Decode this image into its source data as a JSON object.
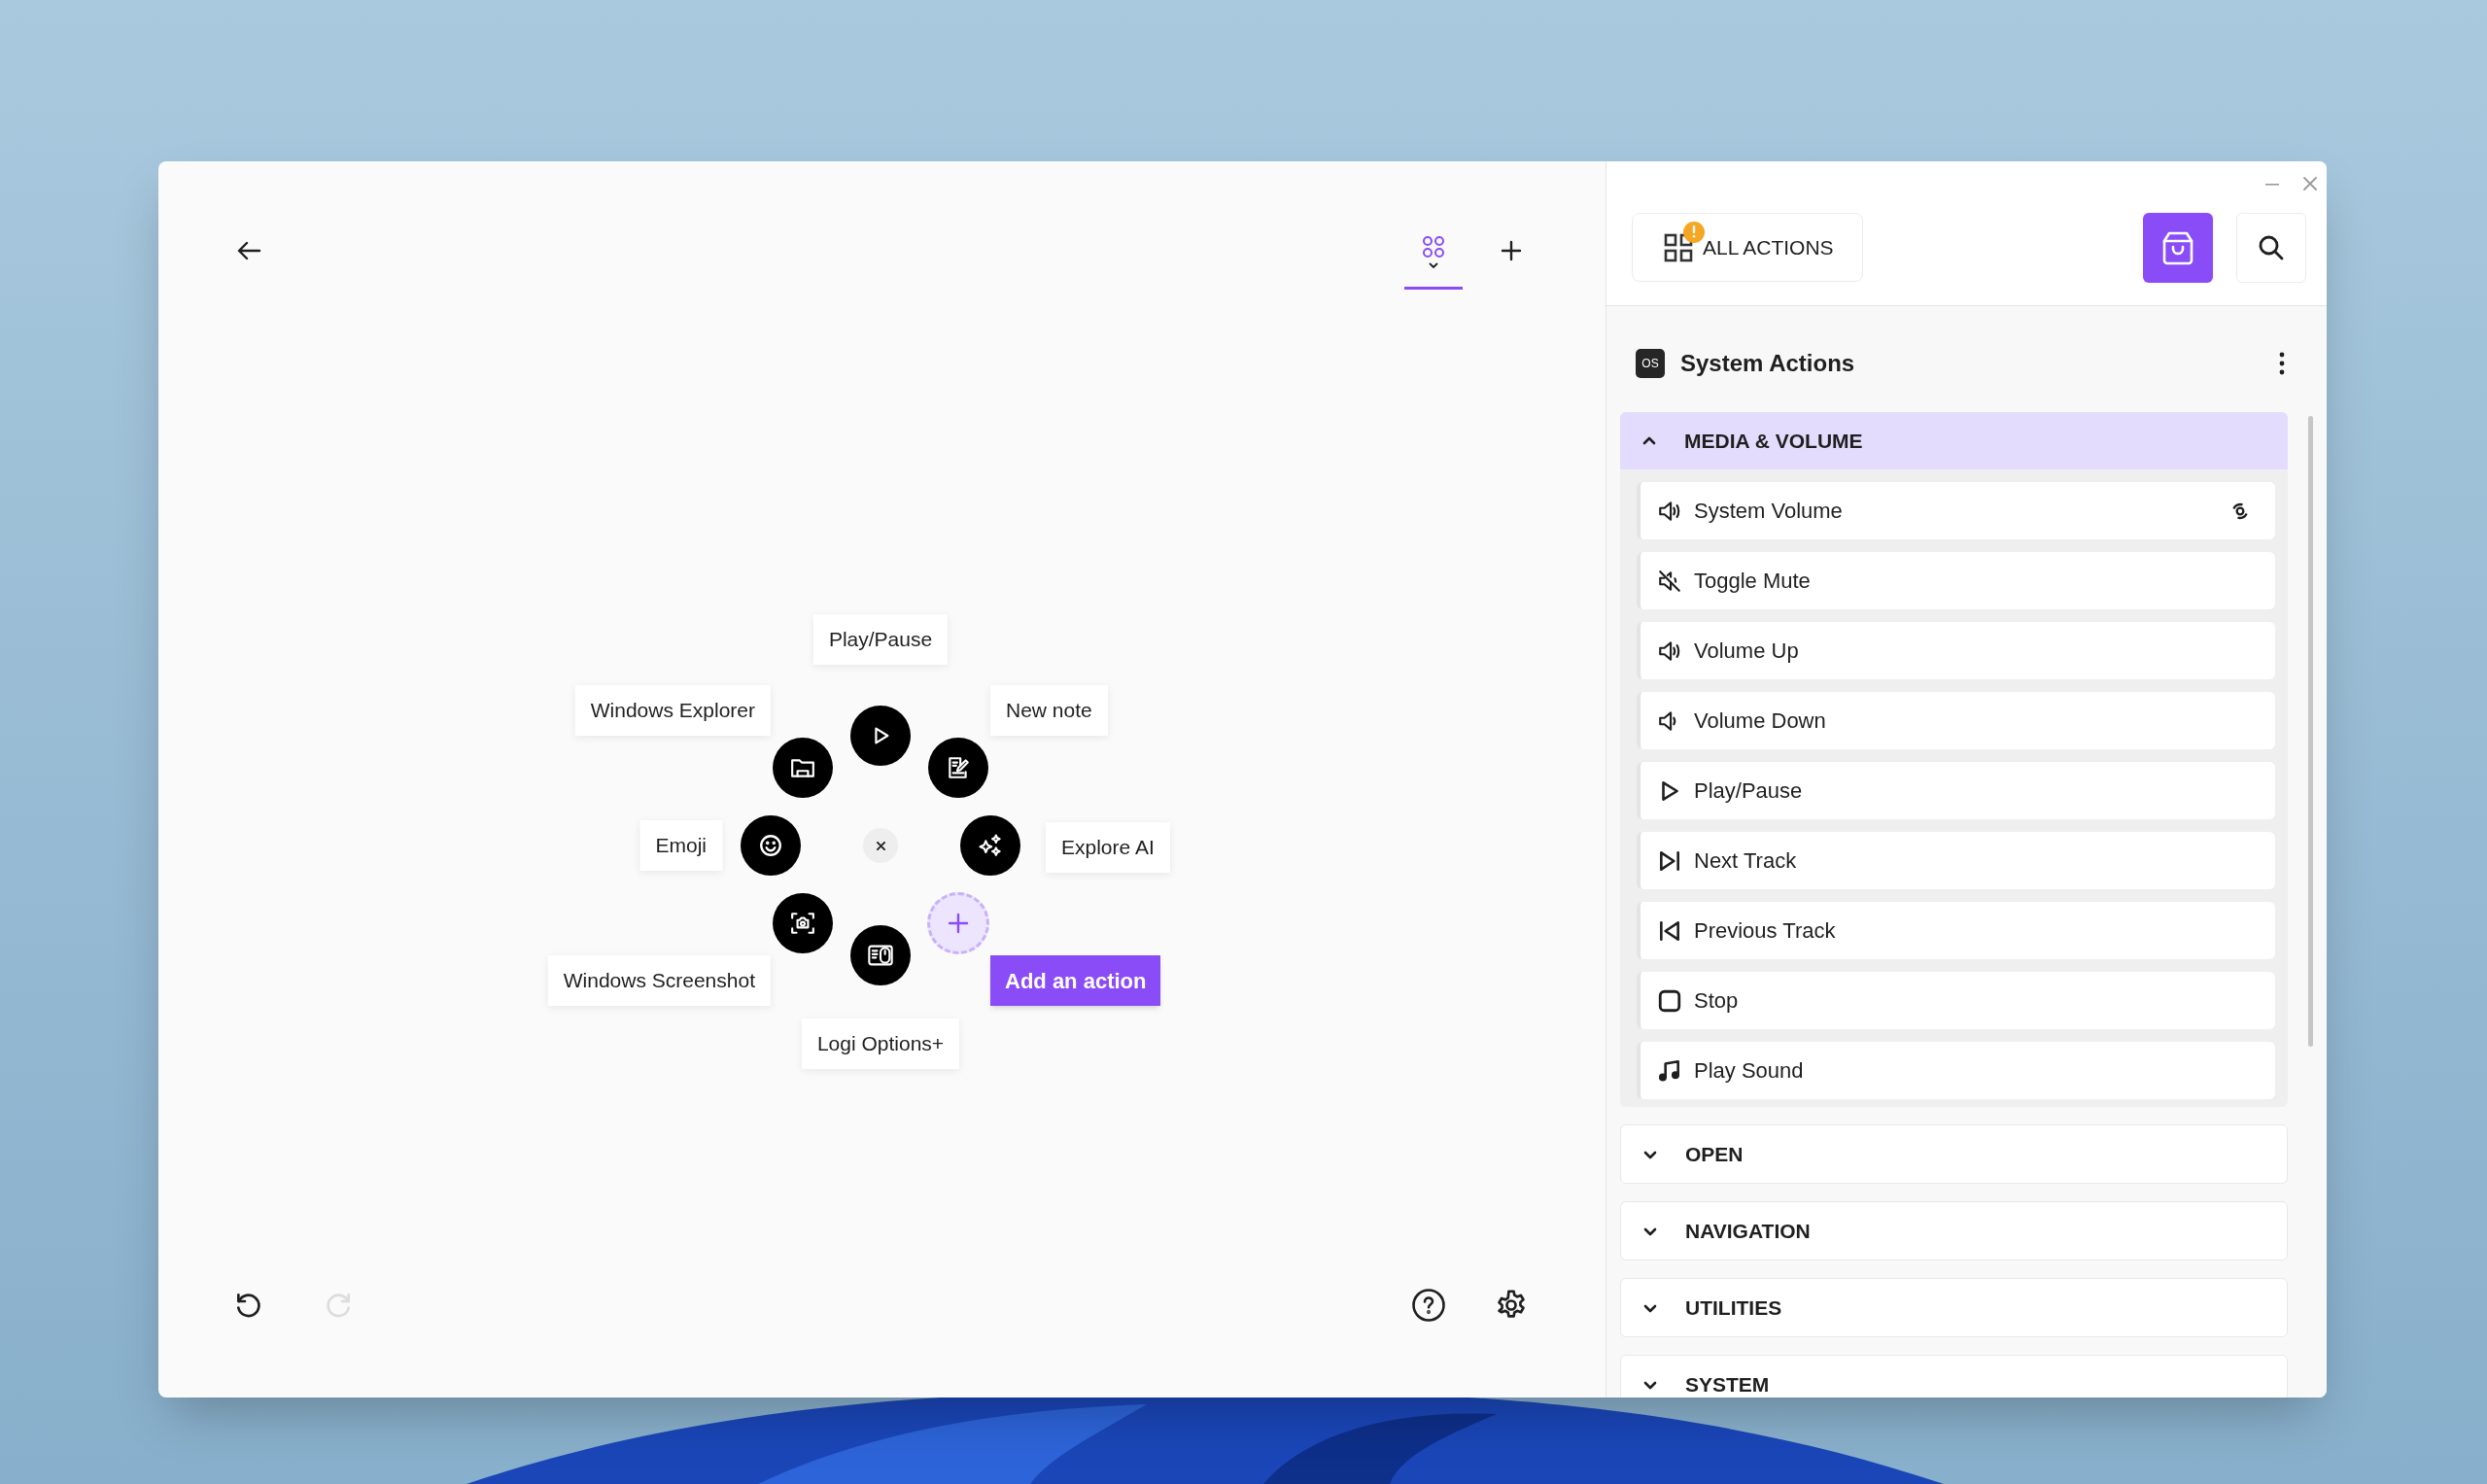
{
  "radial_menu": {
    "slots": [
      {
        "kind": "play",
        "label": "Play/Pause"
      },
      {
        "kind": "folder",
        "label": "Windows Explorer"
      },
      {
        "kind": "note",
        "label": "New note"
      },
      {
        "kind": "emoji",
        "label": "Emoji"
      },
      {
        "kind": "ai",
        "label": "Explore AI"
      },
      {
        "kind": "screenshot",
        "label": "Windows Screenshot"
      },
      {
        "kind": "add",
        "label": "Add an action"
      },
      {
        "kind": "mouse",
        "label": "Logi Options+"
      }
    ]
  },
  "history": {
    "undo": {
      "disabled": false
    },
    "redo": {
      "disabled": true
    }
  },
  "panel": {
    "all_actions": {
      "label": "ALL ACTIONS",
      "alert": true
    },
    "category": {
      "badge": "OS",
      "title": "System Actions"
    },
    "sections": [
      {
        "title": "MEDIA & VOLUME",
        "expanded": true,
        "items": [
          {
            "kind": "volume",
            "label": "System Volume",
            "configurable": true
          },
          {
            "kind": "mute",
            "label": "Toggle Mute",
            "configurable": false
          },
          {
            "kind": "volume",
            "label": "Volume Up",
            "configurable": false
          },
          {
            "kind": "volume-down",
            "label": "Volume Down",
            "configurable": false
          },
          {
            "kind": "play",
            "label": "Play/Pause",
            "configurable": false
          },
          {
            "kind": "next",
            "label": "Next Track",
            "configurable": false
          },
          {
            "kind": "previous",
            "label": "Previous Track",
            "configurable": false
          },
          {
            "kind": "stop",
            "label": "Stop",
            "configurable": false
          },
          {
            "kind": "sound",
            "label": "Play Sound",
            "configurable": false
          }
        ]
      },
      {
        "title": "OPEN",
        "expanded": false
      },
      {
        "title": "NAVIGATION",
        "expanded": false
      },
      {
        "title": "UTILITIES",
        "expanded": false
      },
      {
        "title": "SYSTEM",
        "expanded": false
      }
    ]
  }
}
